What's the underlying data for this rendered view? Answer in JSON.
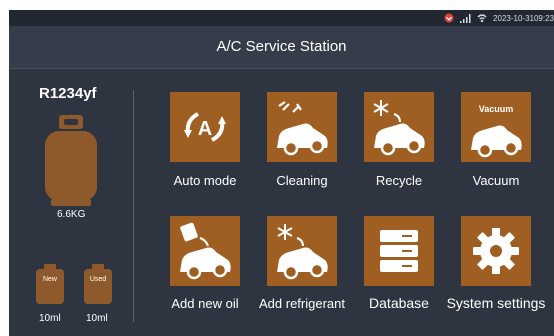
{
  "status_bar": {
    "datetime": "2023-10-3109:23",
    "icons": [
      "alert-icon",
      "signal-icon",
      "wifi-icon"
    ]
  },
  "header": {
    "title": "A/C Service Station"
  },
  "refrigerant": {
    "name": "R1234yf",
    "tank_weight": "6.6KG",
    "new_oil": {
      "label": "New",
      "volume": "10ml"
    },
    "used_oil": {
      "label": "Used",
      "volume": "10ml"
    }
  },
  "menu": {
    "auto_mode": "Auto mode",
    "cleaning": "Cleaning",
    "recycle": "Recycle",
    "vacuum": "Vacuum",
    "vacuum_icon_text": "Vacuum",
    "add_new_oil": "Add new oil",
    "add_refrigerant": "Add refrigerant",
    "database": "Database",
    "system_settings": "System settings"
  },
  "colors": {
    "background": "#2e3440",
    "title_bar": "#363c4a",
    "tile": "#a05f22",
    "tank": "#8e5a2b",
    "alert": "#e0453a"
  }
}
